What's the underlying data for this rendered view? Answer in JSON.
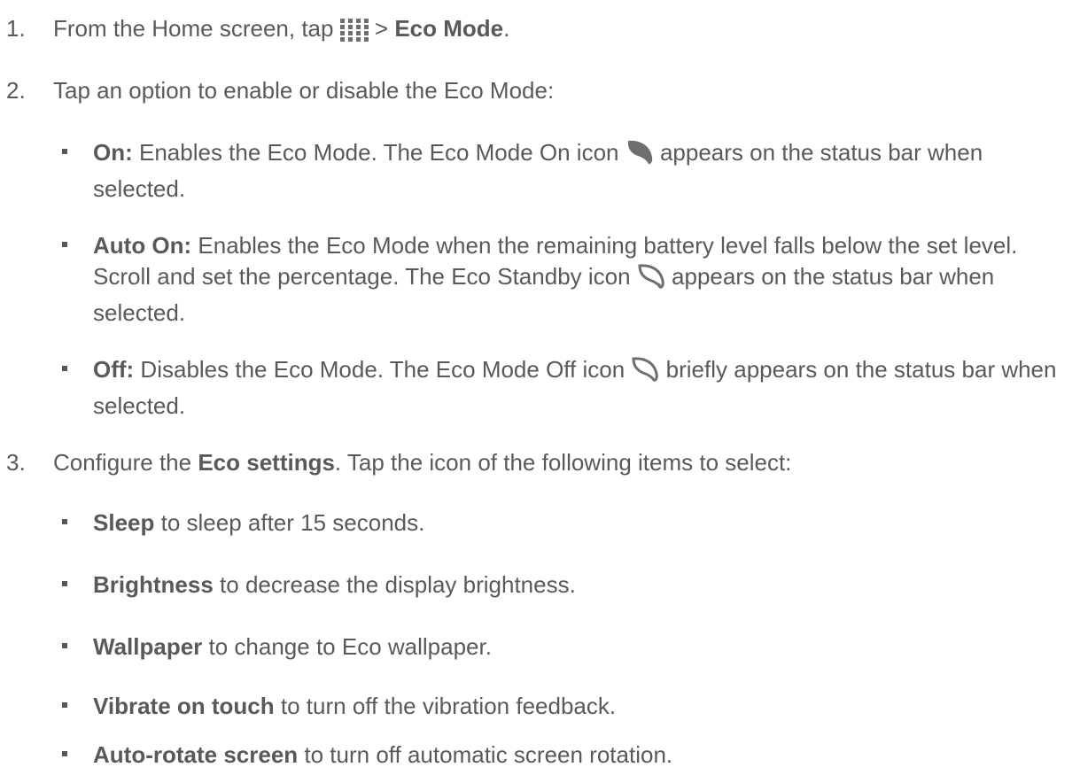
{
  "step1": {
    "number": "1.",
    "text_before": "From the Home screen, tap ",
    "icon": "apps-grid-icon",
    "text_mid": " > ",
    "bold": "Eco Mode",
    "text_after": "."
  },
  "step2": {
    "number": "2.",
    "text": "Tap an option to enable or disable the Eco Mode:"
  },
  "options": [
    {
      "label": "On:",
      "before_icon": " Enables the Eco Mode. The Eco Mode On icon ",
      "icon": "eco-mode-on-leaf-icon",
      "after_icon": " appears on the status bar when selected."
    },
    {
      "label": "Auto On:",
      "before_icon": " Enables the Eco Mode when the remaining battery level falls below the set level. Scroll and set the percentage. The Eco Standby icon ",
      "icon": "eco-standby-leaf-icon",
      "after_icon": " appears on the status bar when selected."
    },
    {
      "label": "Off:",
      "before_icon": " Disables the Eco Mode. The Eco Mode Off icon ",
      "icon": "eco-mode-off-leaf-icon",
      "after_icon": " briefly appears on the status bar when selected."
    }
  ],
  "step3": {
    "number": "3.",
    "text_before": "Configure the ",
    "bold": "Eco settings",
    "text_after": ". Tap the icon of the following items to select:"
  },
  "settings": [
    {
      "label": "Sleep",
      "text": " to sleep after 15 seconds."
    },
    {
      "label": "Brightness",
      "text": " to decrease the display brightness."
    },
    {
      "label": "Wallpaper",
      "text": " to change to Eco wallpaper."
    },
    {
      "label": "Vibrate on touch",
      "text": " to turn off the vibration feedback."
    },
    {
      "label": "Auto-rotate screen",
      "text": " to turn off automatic screen rotation."
    }
  ],
  "colors": {
    "text": "#595959",
    "icon": "#6f6f6f"
  }
}
